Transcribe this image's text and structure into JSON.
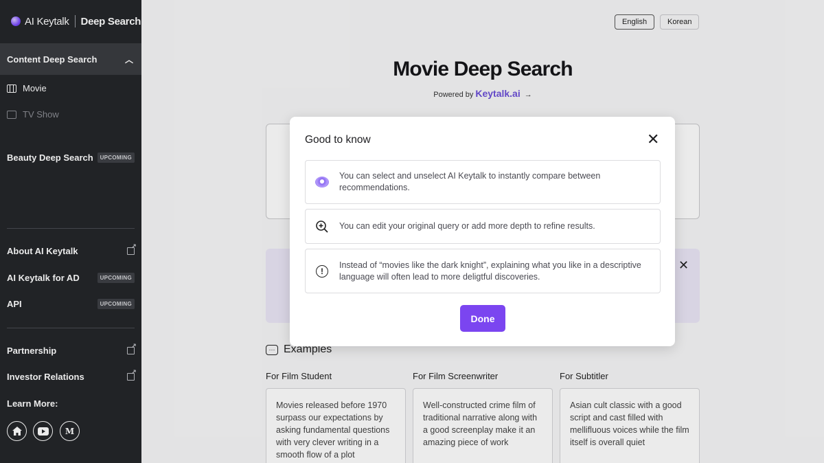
{
  "sidebar": {
    "brand": {
      "ai": "AI Keytalk",
      "product": "Deep Search"
    },
    "section": {
      "label": "Content Deep Search"
    },
    "items": [
      {
        "label": "Movie"
      },
      {
        "label": "TV Show"
      }
    ],
    "beauty": {
      "label": "Beauty Deep Search",
      "badge": "UPCOMING"
    },
    "about": {
      "label": "About AI Keytalk"
    },
    "ad": {
      "label": "AI Keytalk for AD",
      "badge": "UPCOMING"
    },
    "api": {
      "label": "API",
      "badge": "UPCOMING"
    },
    "partnership": {
      "label": "Partnership"
    },
    "investor": {
      "label": "Investor Relations"
    },
    "learn_more": "Learn More:",
    "social_medium": "M"
  },
  "header": {
    "lang_english": "English",
    "lang_korean": "Korean",
    "title": "Movie Deep Search",
    "powered_by": "Powered by",
    "powered_brand": "Keytalk.ai"
  },
  "examples": {
    "heading": "Examples",
    "columns": [
      {
        "title": "For Film Student",
        "text": "Movies released before 1970 surpass our expectations by asking fundamental questions with very clever writing in a smooth flow of a plot"
      },
      {
        "title": "For Film Screenwriter",
        "text": "Well-constructed crime film of traditional narrative along with a good screenplay make it an amazing piece of work"
      },
      {
        "title": "For Subtitler",
        "text": "Asian cult classic with a good script and cast filled with mellifluous voices while the film itself is overall quiet"
      }
    ]
  },
  "modal": {
    "title": "Good to know",
    "tips": [
      {
        "icon": "ai-keytalk-orb-icon",
        "text": "You can select and unselect AI Keytalk to instantly compare between recommendations."
      },
      {
        "icon": "zoom-plus-icon",
        "text": "You can edit your original query or add more depth to refine results."
      },
      {
        "icon": "exclamation-icon",
        "text": "Instead of “movies like the dark knight”, explaining what you like in a descriptive language will often lead to more deligtful discoveries."
      }
    ],
    "done_label": "Done"
  },
  "colors": {
    "accent": "#7b45f0",
    "sidebar_bg": "#24262a",
    "brand_text": "#6b4fd8"
  }
}
